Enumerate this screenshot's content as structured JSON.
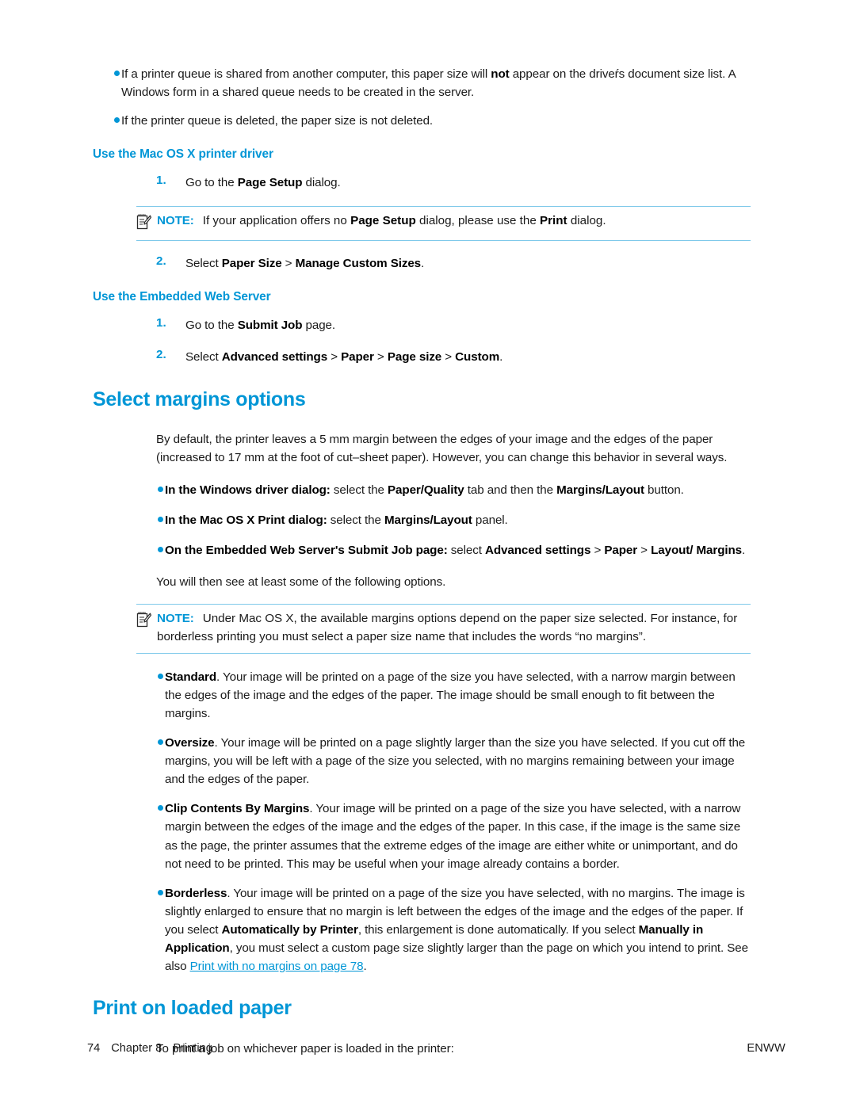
{
  "document": {
    "chapter_blue": "#0096d6",
    "note_rule": "#7fc9ea"
  },
  "intro_bullets": [
    {
      "parts": [
        {
          "t": "If a printer queue is shared from another computer, this paper size will ",
          "b": false
        },
        {
          "t": "not",
          "b": true
        },
        {
          "t": " appear on the driveŕs document size list. A Windows form in a shared queue needs to be created in the server.",
          "b": false
        }
      ]
    },
    {
      "parts": [
        {
          "t": "If the printer queue is deleted, the paper size is not deleted.",
          "b": false
        }
      ]
    }
  ],
  "mac_driver": {
    "heading": "Use the Mac OS X printer driver",
    "steps": [
      {
        "marker": "1.",
        "parts": [
          {
            "t": "Go to the ",
            "b": false
          },
          {
            "t": "Page Setup",
            "b": true
          },
          {
            "t": " dialog.",
            "b": false
          }
        ]
      },
      {
        "marker": "2.",
        "parts": [
          {
            "t": "Select ",
            "b": false
          },
          {
            "t": "Paper Size",
            "b": true
          },
          {
            "t": " > ",
            "b": false
          },
          {
            "t": "Manage Custom Sizes",
            "b": true
          },
          {
            "t": ".",
            "b": false
          }
        ]
      }
    ],
    "note": {
      "label": "NOTE:",
      "parts": [
        {
          "t": "If your application offers no ",
          "b": false
        },
        {
          "t": "Page Setup",
          "b": true
        },
        {
          "t": " dialog, please use the ",
          "b": false
        },
        {
          "t": "Print",
          "b": true
        },
        {
          "t": " dialog.",
          "b": false
        }
      ]
    }
  },
  "ews": {
    "heading": "Use the Embedded Web Server",
    "steps": [
      {
        "marker": "1.",
        "parts": [
          {
            "t": "Go to the ",
            "b": false
          },
          {
            "t": "Submit Job",
            "b": true
          },
          {
            "t": " page.",
            "b": false
          }
        ]
      },
      {
        "marker": "2.",
        "parts": [
          {
            "t": "Select ",
            "b": false
          },
          {
            "t": "Advanced settings",
            "b": true
          },
          {
            "t": " > ",
            "b": false
          },
          {
            "t": "Paper",
            "b": true
          },
          {
            "t": " > ",
            "b": false
          },
          {
            "t": "Page size",
            "b": true
          },
          {
            "t": " > ",
            "b": false
          },
          {
            "t": "Custom",
            "b": true
          },
          {
            "t": ".",
            "b": false
          }
        ]
      }
    ]
  },
  "margins_section": {
    "title": "Select margins options",
    "intro": "By default, the printer leaves a 5 mm margin between the edges of your image and the edges of the paper (increased to 17 mm at the foot of cut–sheet paper). However, you can change this behavior in several ways.",
    "dialog_bullets": [
      {
        "parts": [
          {
            "t": "In the Windows driver dialog:",
            "b": true
          },
          {
            "t": " select the ",
            "b": false
          },
          {
            "t": "Paper/Quality",
            "b": true
          },
          {
            "t": " tab and then the ",
            "b": false
          },
          {
            "t": "Margins/Layout",
            "b": true
          },
          {
            "t": " button.",
            "b": false
          }
        ]
      },
      {
        "parts": [
          {
            "t": "In the Mac OS X Print dialog:",
            "b": true
          },
          {
            "t": " select the ",
            "b": false
          },
          {
            "t": "Margins/Layout",
            "b": true
          },
          {
            "t": " panel.",
            "b": false
          }
        ]
      },
      {
        "parts": [
          {
            "t": "On the Embedded Web Server's Submit Job page:",
            "b": true
          },
          {
            "t": " select ",
            "b": false
          },
          {
            "t": "Advanced settings",
            "b": true
          },
          {
            "t": " > ",
            "b": false
          },
          {
            "t": "Paper",
            "b": true
          },
          {
            "t": " > ",
            "b": false
          },
          {
            "t": "Layout/ Margins",
            "b": true
          },
          {
            "t": ".",
            "b": false
          }
        ]
      }
    ],
    "after_bullets": "You will then see at least some of the following options.",
    "note": {
      "label": "NOTE:",
      "parts": [
        {
          "t": "Under Mac OS X, the available margins options depend on the paper size selected. For instance, for borderless printing you must select a paper size name that includes the words “no margins”.",
          "b": false
        }
      ]
    },
    "option_bullets": [
      {
        "parts": [
          {
            "t": "Standard",
            "b": true
          },
          {
            "t": ". Your image will be printed on a page of the size you have selected, with a narrow margin between the edges of the image and the edges of the paper. The image should be small enough to fit between the margins.",
            "b": false
          }
        ]
      },
      {
        "parts": [
          {
            "t": "Oversize",
            "b": true
          },
          {
            "t": ". Your image will be printed on a page slightly larger than the size you have selected. If you cut off the margins, you will be left with a page of the size you selected, with no margins remaining between your image and the edges of the paper.",
            "b": false
          }
        ]
      },
      {
        "parts": [
          {
            "t": "Clip Contents By Margins",
            "b": true
          },
          {
            "t": ". Your image will be printed on a page of the size you have selected, with a narrow margin between the edges of the image and the edges of the paper. In this case, if the image is the same size as the page, the printer assumes that the extreme edges of the image are either white or unimportant, and do not need to be printed. This may be useful when your image already contains a border.",
            "b": false
          }
        ]
      },
      {
        "parts": [
          {
            "t": "Borderless",
            "b": true
          },
          {
            "t": ". Your image will be printed on a page of the size you have selected, with no margins. The image is slightly enlarged to ensure that no margin is left between the edges of the image and the edges of the paper. If you select ",
            "b": false
          },
          {
            "t": "Automatically by Printer",
            "b": true
          },
          {
            "t": ", this enlargement is done automatically. If you select ",
            "b": false
          },
          {
            "t": "Manually in Application",
            "b": true
          },
          {
            "t": ", you must select a custom page size slightly larger than the page on which you intend to print. See also ",
            "b": false
          },
          {
            "t": "Print with no margins on page 78",
            "b": false,
            "link": true
          },
          {
            "t": ".",
            "b": false
          }
        ]
      }
    ]
  },
  "loaded_paper_section": {
    "title": "Print on loaded paper",
    "intro": "To print a job on whichever paper is loaded in the printer:"
  },
  "footer": {
    "page_number": "74",
    "chapter": "Chapter 8",
    "chapter_title": "Printing",
    "right": "ENWW"
  }
}
